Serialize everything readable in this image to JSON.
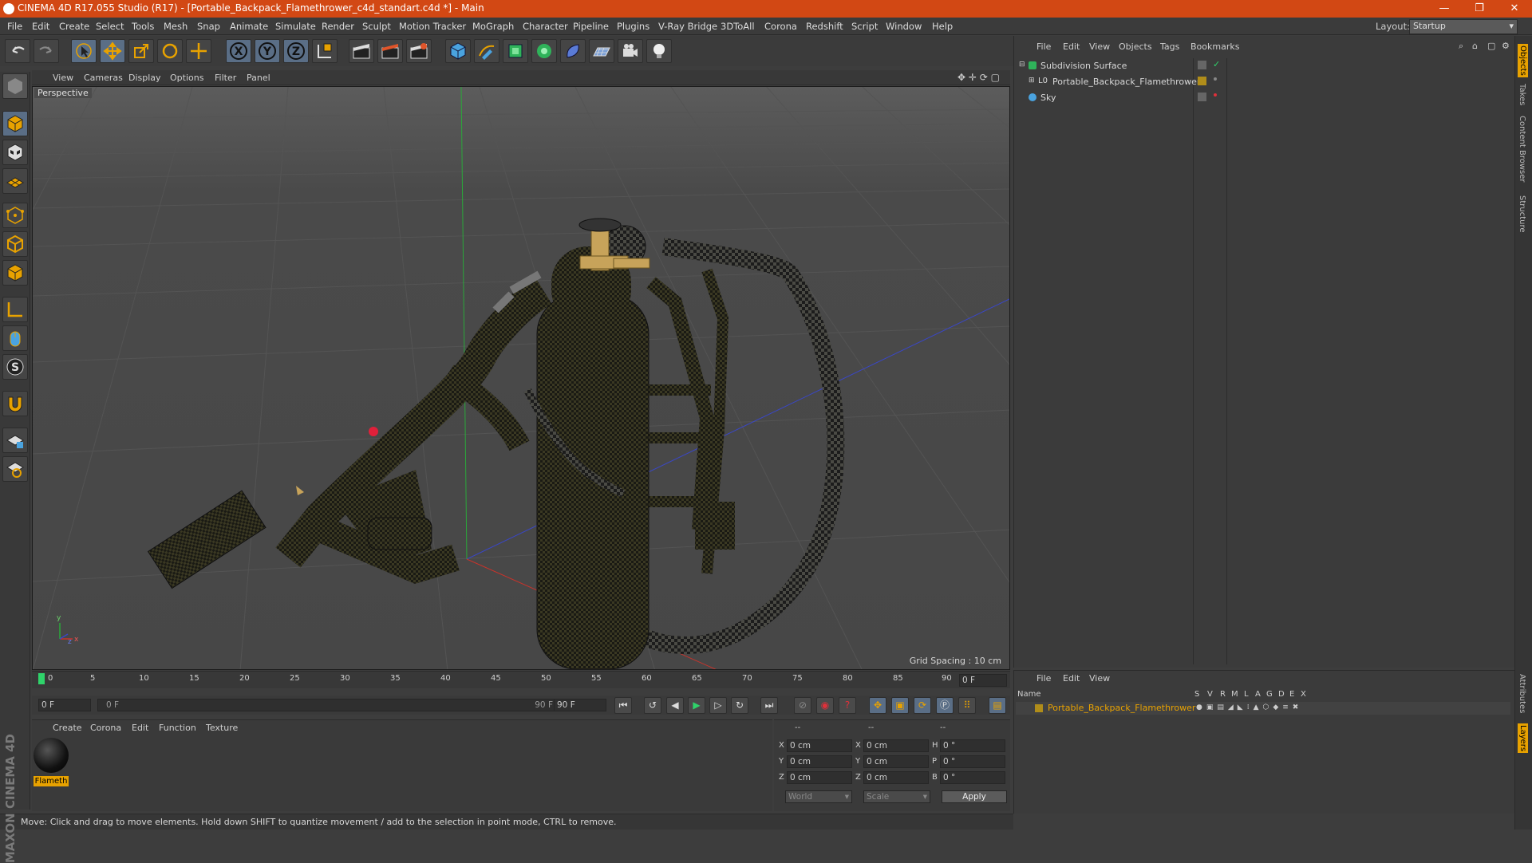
{
  "window": {
    "title": "CINEMA 4D R17.055 Studio (R17) - [Portable_Backpack_Flamethrower_c4d_standart.c4d *] - Main",
    "minimize": "—",
    "restore": "❐",
    "close": "✕"
  },
  "menubar": {
    "items": [
      "File",
      "Edit",
      "Create",
      "Select",
      "Tools",
      "Mesh",
      "Snap",
      "Animate",
      "Simulate",
      "Render",
      "Sculpt",
      "Motion Tracker",
      "MoGraph",
      "Character",
      "Pipeline",
      "Plugins",
      "V-Ray Bridge",
      "3DToAll",
      "Corona",
      "Redshift",
      "Script",
      "Window",
      "Help"
    ],
    "layout_label": "Layout:",
    "layout_value": "Startup"
  },
  "toolbar": {
    "axis_x": "X",
    "axis_y": "Y",
    "axis_z": "Z"
  },
  "viewport": {
    "menu": [
      "View",
      "Cameras",
      "Display",
      "Options",
      "Filter",
      "Panel"
    ],
    "camera_label": "Perspective",
    "grid_spacing": "Grid Spacing : 10 cm",
    "axis_x": "x",
    "axis_y": "y",
    "axis_z": "z"
  },
  "timeline": {
    "ticks": [
      "0",
      "5",
      "10",
      "15",
      "20",
      "25",
      "30",
      "35",
      "40",
      "45",
      "50",
      "55",
      "60",
      "65",
      "70",
      "75",
      "80",
      "85",
      "90"
    ],
    "current_frame": "0 F"
  },
  "playbar": {
    "start_field": "0 F",
    "range_start": "0 F",
    "range_end": "90 F",
    "end_field": "90 F"
  },
  "material_panel": {
    "menu": [
      "Create",
      "Corona",
      "Edit",
      "Function",
      "Texture"
    ],
    "material_name": "Flameth"
  },
  "coord_panel": {
    "headers": [
      "--",
      "--",
      "--"
    ],
    "rows": [
      {
        "l1": "X",
        "v1": "0 cm",
        "l2": "X",
        "v2": "0 cm",
        "l3": "H",
        "v3": "0 °"
      },
      {
        "l1": "Y",
        "v1": "0 cm",
        "l2": "Y",
        "v2": "0 cm",
        "l3": "P",
        "v3": "0 °"
      },
      {
        "l1": "Z",
        "v1": "0 cm",
        "l2": "Z",
        "v2": "0 cm",
        "l3": "B",
        "v3": "0 °"
      }
    ],
    "world_select": "World",
    "scale_select": "Scale",
    "apply_label": "Apply"
  },
  "object_manager": {
    "menu": [
      "File",
      "Edit",
      "View",
      "Objects",
      "Tags",
      "Bookmarks"
    ],
    "objects": [
      {
        "name": "Subdivision Surface"
      },
      {
        "name": "Portable_Backpack_Flamethrower"
      },
      {
        "name": "Sky"
      }
    ]
  },
  "layer_manager": {
    "menu": [
      "File",
      "Edit",
      "View"
    ],
    "name_header": "Name",
    "columns": [
      "S",
      "V",
      "R",
      "M",
      "L",
      "A",
      "G",
      "D",
      "E",
      "X"
    ],
    "layer_name": "Portable_Backpack_Flamethrower"
  },
  "side_tabs": [
    "Objects",
    "Takes",
    "Content Browser",
    "Structure",
    "Attributes",
    "Layers"
  ],
  "status": {
    "text": "Move: Click and drag to move elements. Hold down SHIFT to quantize movement / add to the selection in point mode, CTRL to remove."
  },
  "logo": "MAXON CINEMA 4D",
  "colors": {
    "titlebar": "#d24814",
    "accent": "#e8a200",
    "selected_tool": "#5a6e86"
  }
}
